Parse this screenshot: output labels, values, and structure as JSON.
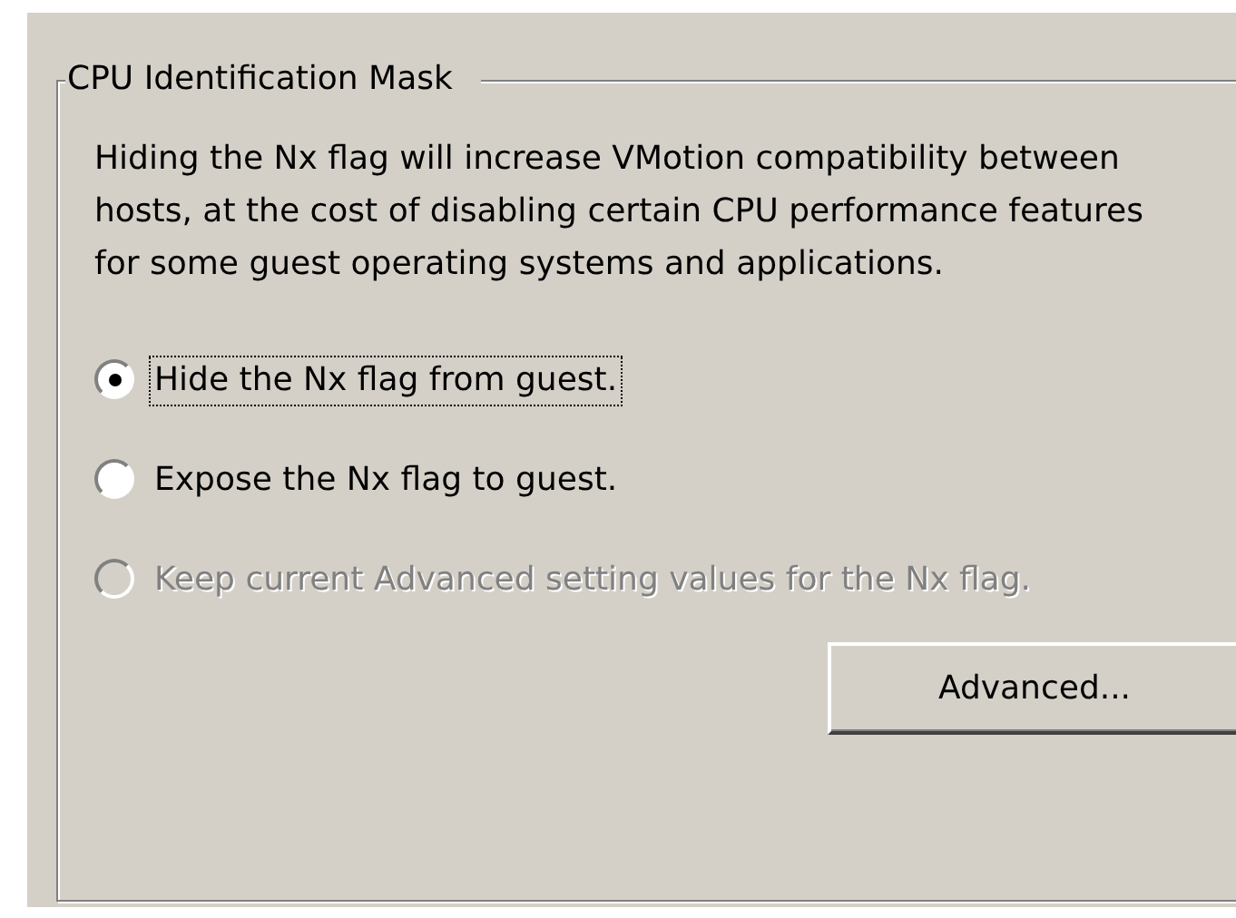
{
  "group_box": {
    "title": "CPU Identification Mask",
    "description": "Hiding the Nx flag will increase VMotion compatibility between hosts, at the cost of disabling certain CPU performance features for some guest operating systems and applications.",
    "options": [
      {
        "label": "Hide the Nx flag from guest.",
        "selected": true,
        "focused": true,
        "disabled": false
      },
      {
        "label": "Expose the Nx flag to guest.",
        "selected": false,
        "focused": false,
        "disabled": false
      },
      {
        "label": "Keep current Advanced setting values for the Nx flag.",
        "selected": false,
        "focused": false,
        "disabled": true
      }
    ],
    "button": "Advanced..."
  }
}
